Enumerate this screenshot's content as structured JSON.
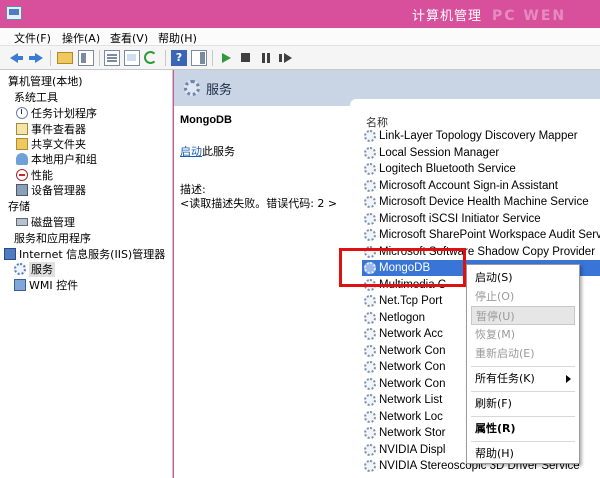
{
  "window": {
    "title": "计算机管理",
    "watermark": "PC WEN"
  },
  "menu": [
    "文件(F)",
    "操作(A)",
    "查看(V)",
    "帮助(H)"
  ],
  "tree": [
    {
      "label": "算机管理(本地)",
      "icon": "computer-icon",
      "indent": 0
    },
    {
      "label": "系统工具",
      "icon": "tools-icon",
      "indent": 1
    },
    {
      "label": "任务计划程序",
      "icon": "clock-icon",
      "indent": 2
    },
    {
      "label": "事件查看器",
      "icon": "event-log-icon",
      "indent": 2
    },
    {
      "label": "共享文件夹",
      "icon": "shared-folder-icon",
      "indent": 2
    },
    {
      "label": "本地用户和组",
      "icon": "users-icon",
      "indent": 2
    },
    {
      "label": "性能",
      "icon": "performance-icon",
      "indent": 2
    },
    {
      "label": "设备管理器",
      "icon": "device-manager-icon",
      "indent": 2
    },
    {
      "label": "存储",
      "icon": "storage-icon",
      "indent": 0
    },
    {
      "label": "磁盘管理",
      "icon": "disk-icon",
      "indent": 2
    },
    {
      "label": "服务和应用程序",
      "icon": "services-apps-icon",
      "indent": 1
    },
    {
      "label": "Internet 信息服务(IIS)管理器",
      "icon": "iis-icon",
      "indent": 2
    },
    {
      "label": "服务",
      "icon": "services-icon",
      "indent": 2,
      "selected": true
    },
    {
      "label": "WMI 控件",
      "icon": "wmi-icon",
      "indent": 2
    }
  ],
  "panel": {
    "title": "服务",
    "service_name": "MongoDB",
    "start_link": "启动",
    "start_suffix": "此服务",
    "desc_label": "描述:",
    "desc_text": "<读取描述失败。错误代码: 2 >"
  },
  "list": {
    "column": "名称",
    "rows": [
      "Link-Layer Topology Discovery Mapper",
      "Local Session Manager",
      "Logitech Bluetooth Service",
      "Microsoft Account Sign-in Assistant",
      "Microsoft Device Health Machine Service",
      "Microsoft iSCSI Initiator Service",
      "Microsoft SharePoint Workspace Audit Serv",
      "Microsoft Software Shadow Copy Provider",
      "MongoDB",
      "Multimedia C",
      "Net.Tcp Port",
      "Netlogon",
      "Network Acc",
      "Network Con",
      "Network Con",
      "Network Con",
      "Network List",
      "Network Loc",
      "Network Stor",
      "NVIDIA Displ",
      "NVIDIA Stereoscopic 3D Driver Service"
    ],
    "selected": "MongoDB"
  },
  "context_menu": [
    {
      "label": "启动(S)",
      "state": "enabled"
    },
    {
      "label": "停止(O)",
      "state": "disabled"
    },
    {
      "label": "暂停(U)",
      "state": "hover-disabled"
    },
    {
      "label": "恢复(M)",
      "state": "disabled"
    },
    {
      "label": "重新启动(E)",
      "state": "disabled"
    },
    {
      "label": "所有任务(K)",
      "state": "submenu"
    },
    {
      "label": "刷新(F)",
      "state": "enabled"
    },
    {
      "label": "属性(R)",
      "state": "bold"
    },
    {
      "label": "帮助(H)",
      "state": "enabled"
    }
  ],
  "colors": {
    "titlebar": "#d84f9c",
    "selection": "#3875d7",
    "highlight_box": "#e01010"
  }
}
